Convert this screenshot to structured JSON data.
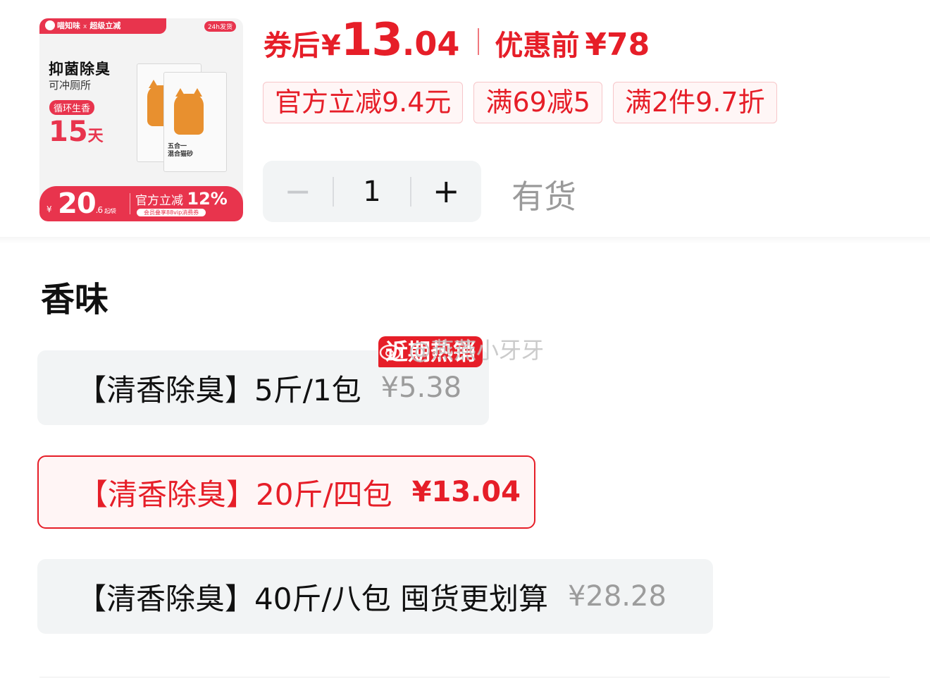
{
  "thumbnail": {
    "brand": "喵知味",
    "x": "x",
    "campaign": "超级立减",
    "shipping": "24h发货",
    "headline": "抑菌除臭",
    "subline": "可冲厕所",
    "tag": "循环生香",
    "days_number": "15",
    "days_unit": "天",
    "bag_text": "五合一\n混合猫砂",
    "bottom_yen": "¥",
    "bottom_price": "20",
    "bottom_price_dec": ".6",
    "bottom_unit": "起/袋",
    "bottom_off_label": "官方立减",
    "bottom_off_value": "12%",
    "bottom_vip": "会员叠享88vip消费券"
  },
  "price": {
    "after_coupon_label": "券后",
    "yen": "¥",
    "after_coupon_int": "13",
    "after_coupon_dec": ".04",
    "before_label": "优惠前",
    "before_value": "¥78"
  },
  "coupons": [
    "官方立减9.4元",
    "满69减5",
    "满2件9.7折"
  ],
  "quantity": {
    "minus": "−",
    "value": "1",
    "plus": "+"
  },
  "stock_status": "有货",
  "variants": {
    "title": "香味",
    "hot_badge": "近期热销",
    "items": [
      {
        "name": "【清香除臭】5斤/1包",
        "price": "¥5.38",
        "selected": false
      },
      {
        "name": "【清香除臭】20斤/四包",
        "price": "¥13.04",
        "selected": true
      },
      {
        "name": "【清香除臭】40斤/八包 囤货更划算",
        "price": "¥28.28",
        "selected": false
      }
    ]
  },
  "watermark": "@燕燕小牙牙",
  "colors": {
    "accent": "#e61e28",
    "chip_bg": "#fff6f6",
    "option_bg": "#f2f4f5"
  }
}
